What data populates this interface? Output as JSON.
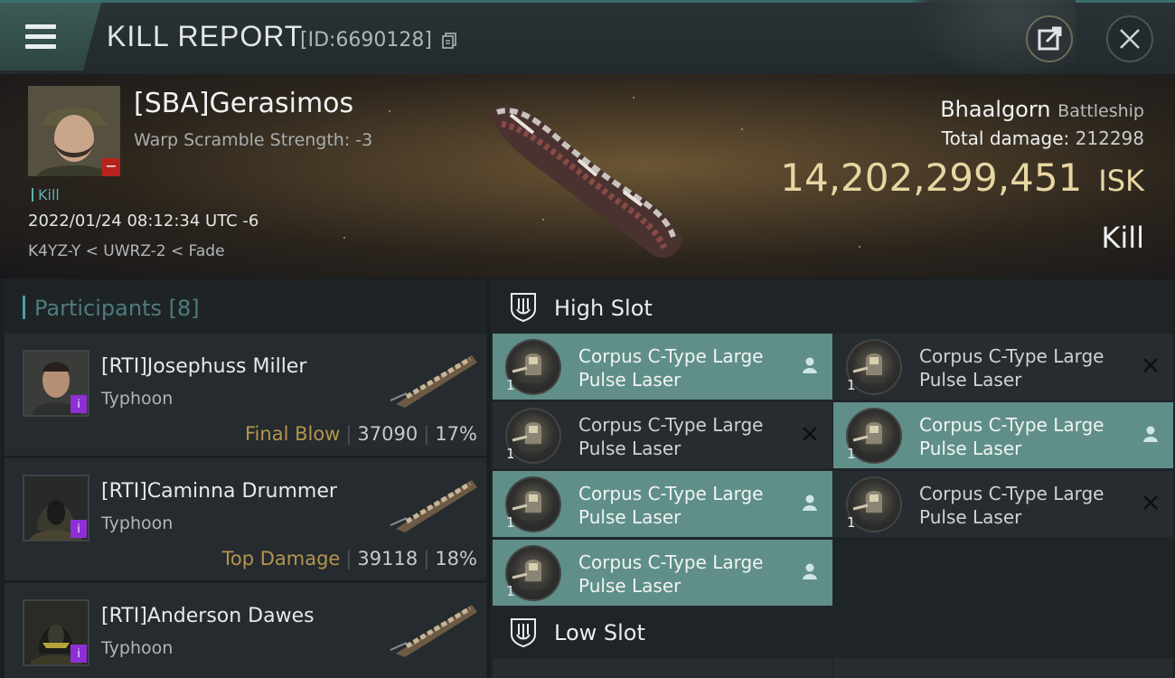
{
  "header": {
    "title": "KILL REPORT",
    "report_id": "[ID:6690128]"
  },
  "victim": {
    "name": "[SBA]Gerasimos",
    "scramble": "Warp Scramble Strength: -3",
    "kill_tag": "Kill",
    "datetime": "2022/01/24 08:12:34 UTC -6",
    "location": "K4YZ-Y < UWRZ-2 < Fade",
    "ship": "Bhaalgorn",
    "ship_class": "Battleship",
    "total_damage_label": "Total damage:",
    "total_damage": "212298",
    "isk_value": "14,202,299,451",
    "isk_unit": "ISK",
    "result": "Kill"
  },
  "participants": {
    "title": "Participants",
    "count": "[8]",
    "items": [
      {
        "name": "[RTI]Josephuss Miller",
        "ship": "Typhoon",
        "tag": "Final Blow",
        "damage": "37090",
        "percent": "17%"
      },
      {
        "name": "[RTI]Caminna Drummer",
        "ship": "Typhoon",
        "tag": "Top Damage",
        "damage": "39118",
        "percent": "18%"
      },
      {
        "name": "[RTI]Anderson Dawes",
        "ship": "Typhoon",
        "tag": "",
        "damage": "",
        "percent": ""
      }
    ]
  },
  "fitting": {
    "high_slot_label": "High Slot",
    "low_slot_label": "Low Slot",
    "modules": [
      {
        "line1": "Corpus C-Type Large",
        "line2": "Pulse Laser",
        "qty": "1",
        "status": "dropped"
      },
      {
        "line1": "Corpus C-Type Large",
        "line2": "Pulse Laser",
        "qty": "1",
        "status": "destroyed"
      },
      {
        "line1": "Corpus C-Type Large",
        "line2": "Pulse Laser",
        "qty": "1",
        "status": "destroyed"
      },
      {
        "line1": "Corpus C-Type Large",
        "line2": "Pulse Laser",
        "qty": "1",
        "status": "dropped"
      },
      {
        "line1": "Corpus C-Type Large",
        "line2": "Pulse Laser",
        "qty": "1",
        "status": "dropped"
      },
      {
        "line1": "Corpus C-Type Large",
        "line2": "Pulse Laser",
        "qty": "1",
        "status": "destroyed"
      },
      {
        "line1": "Corpus C-Type Large",
        "line2": "Pulse Laser",
        "qty": "1",
        "status": "dropped"
      }
    ]
  },
  "colors": {
    "dropped": "#5f8f88",
    "destroyed": "#262c2f",
    "isk": "#e6d6a2",
    "accent": "#4f9ea0"
  }
}
